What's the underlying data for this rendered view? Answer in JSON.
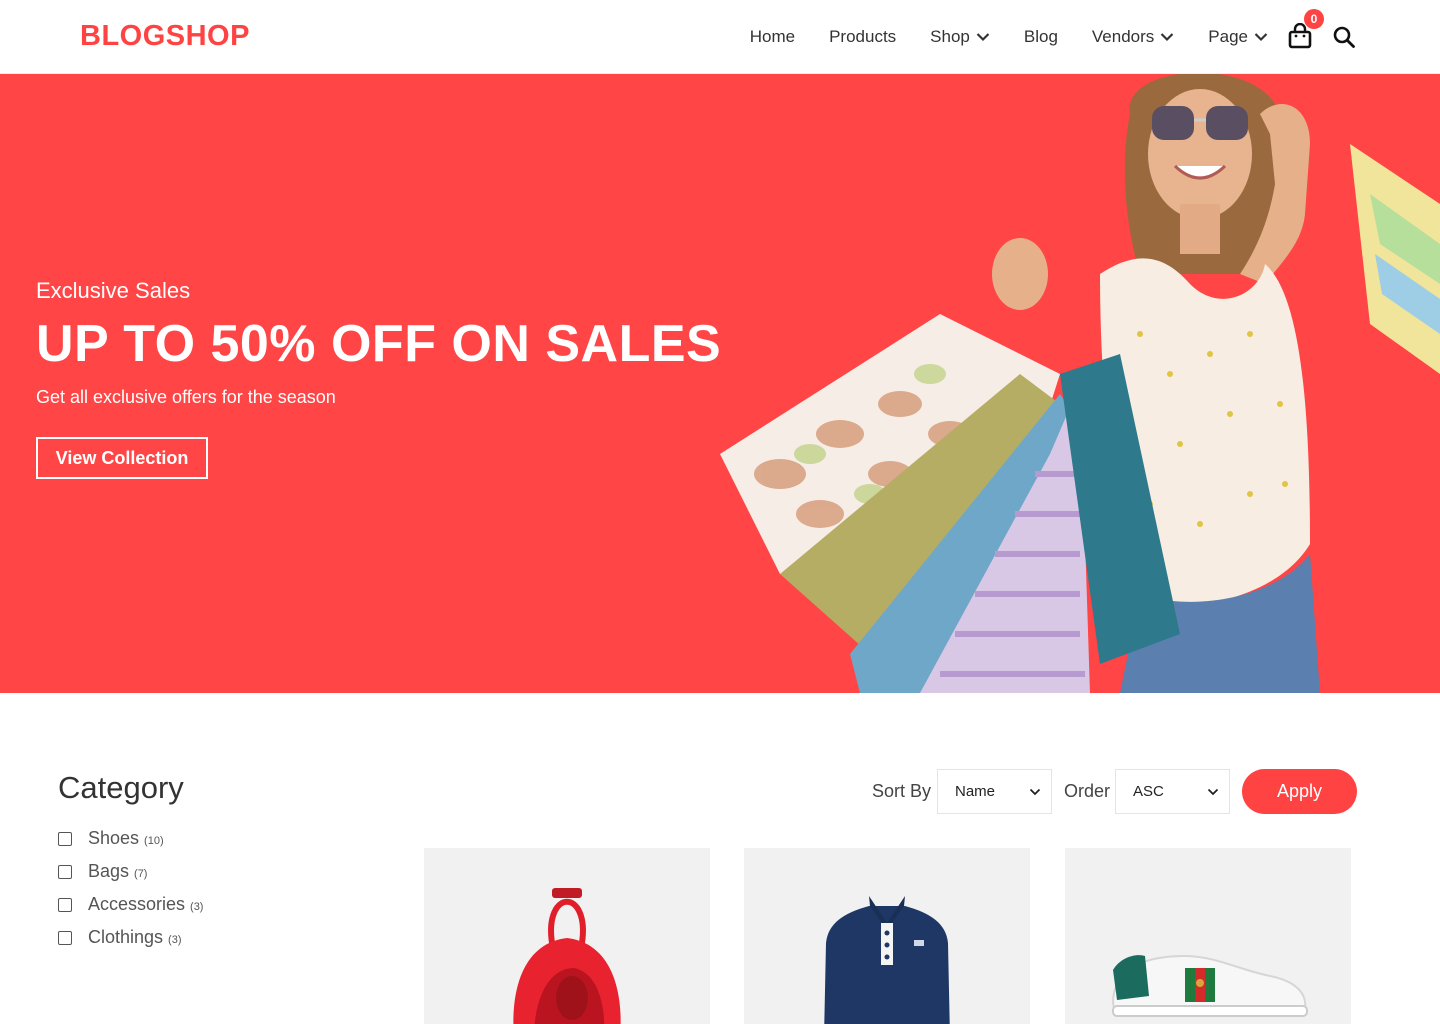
{
  "header": {
    "logo": "BLOGSHOP",
    "nav": [
      {
        "label": "Home",
        "dropdown": false
      },
      {
        "label": "Products",
        "dropdown": false
      },
      {
        "label": "Shop",
        "dropdown": true
      },
      {
        "label": "Blog",
        "dropdown": false
      },
      {
        "label": "Vendors",
        "dropdown": true
      },
      {
        "label": "Page",
        "dropdown": true
      }
    ],
    "cart_count": "0",
    "icons": [
      "shopping-bag-icon",
      "search-icon"
    ]
  },
  "hero": {
    "subtitle": "Exclusive Sales",
    "title": "UP TO 50% OFF ON SALES",
    "description": "Get all exclusive offers for the season",
    "button": "View Collection"
  },
  "sidebar": {
    "title": "Category",
    "categories": [
      {
        "name": "Shoes",
        "count": "(10)"
      },
      {
        "name": "Bags",
        "count": "(7)"
      },
      {
        "name": "Accessories",
        "count": "(3)"
      },
      {
        "name": "Clothings",
        "count": "(3)"
      }
    ]
  },
  "sorting": {
    "sort_label": "Sort By",
    "sort_value": "Name",
    "order_label": "Order",
    "order_value": "ASC",
    "apply": "Apply"
  },
  "products": [
    {
      "image": "red-backpack"
    },
    {
      "image": "navy-polo-shirt"
    },
    {
      "image": "white-sneaker"
    }
  ],
  "colors": {
    "accent": "#ff4343",
    "hero_bg": "#ff4545",
    "product_bg": "#f1f1f1"
  }
}
